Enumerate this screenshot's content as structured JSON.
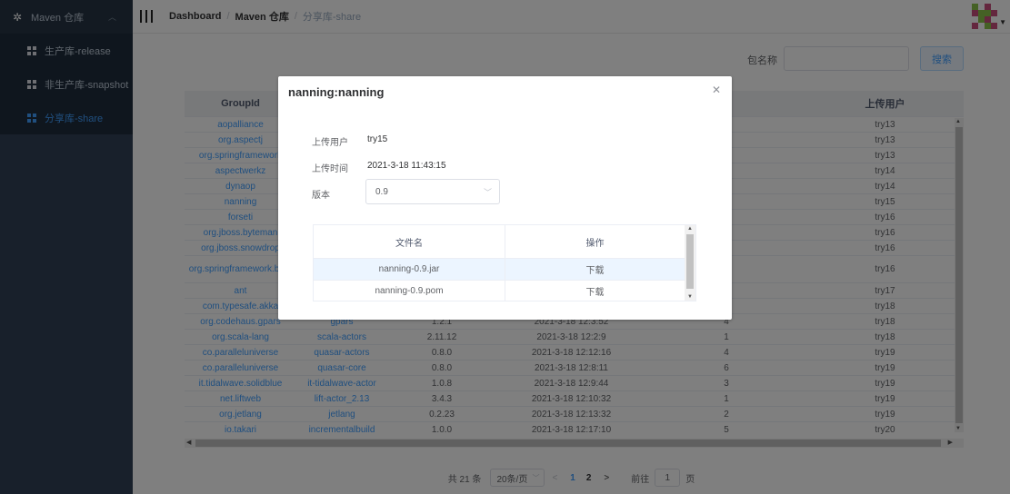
{
  "sidebar": {
    "title": "Maven 仓库",
    "items": [
      {
        "label": "生产库-release",
        "active": false
      },
      {
        "label": "非生产库-snapshot",
        "active": false
      },
      {
        "label": "分享库-share",
        "active": true
      }
    ]
  },
  "header": {
    "breadcrumb": [
      "Dashboard",
      "Maven 仓库",
      "分享库-share"
    ]
  },
  "search": {
    "label": "包名称",
    "value": "",
    "button": "搜索"
  },
  "table": {
    "columns": [
      "GroupId",
      "",
      "",
      "",
      "数",
      "上传用户"
    ],
    "rows": [
      {
        "group": "aopalliance",
        "artifact": "",
        "version": "",
        "time": "",
        "count": "",
        "user": "try13"
      },
      {
        "group": "org.aspectj",
        "artifact": "",
        "version": "",
        "time": "",
        "count": "",
        "user": "try13"
      },
      {
        "group": "org.springframework",
        "artifact": "",
        "version": "",
        "time": "",
        "count": "",
        "user": "try13"
      },
      {
        "group": "aspectwerkz",
        "artifact": "",
        "version": "",
        "time": "",
        "count": "",
        "user": "try14"
      },
      {
        "group": "dynaop",
        "artifact": "",
        "version": "",
        "time": "",
        "count": "",
        "user": "try14"
      },
      {
        "group": "nanning",
        "artifact": "",
        "version": "",
        "time": "",
        "count": "",
        "user": "try15"
      },
      {
        "group": "forseti",
        "artifact": "",
        "version": "",
        "time": "",
        "count": "",
        "user": "try16"
      },
      {
        "group": "org.jboss.byteman",
        "artifact": "",
        "version": "",
        "time": "",
        "count": "",
        "user": "try16"
      },
      {
        "group": "org.jboss.snowdrop",
        "artifact": "",
        "version": "",
        "time": "",
        "count": "",
        "user": "try16"
      },
      {
        "group": "org.springframework.boot",
        "artifact": "",
        "version": "",
        "time": "",
        "count": "",
        "user": "try16",
        "tall": true
      },
      {
        "group": "ant",
        "artifact": "",
        "version": "",
        "time": "",
        "count": "",
        "user": "try17"
      },
      {
        "group": "com.typesafe.akka",
        "artifact": "",
        "version": "",
        "time": "",
        "count": "",
        "user": "try18"
      },
      {
        "group": "org.codehaus.gpars",
        "artifact": "gpars",
        "version": "1.2.1",
        "time": "2021-3-18 12:3:52",
        "count": "4",
        "user": "try18"
      },
      {
        "group": "org.scala-lang",
        "artifact": "scala-actors",
        "version": "2.11.12",
        "time": "2021-3-18 12:2:9",
        "count": "1",
        "user": "try18"
      },
      {
        "group": "co.paralleluniverse",
        "artifact": "quasar-actors",
        "version": "0.8.0",
        "time": "2021-3-18 12:12:16",
        "count": "4",
        "user": "try19"
      },
      {
        "group": "co.paralleluniverse",
        "artifact": "quasar-core",
        "version": "0.8.0",
        "time": "2021-3-18 12:8:11",
        "count": "6",
        "user": "try19"
      },
      {
        "group": "it.tidalwave.solidblue",
        "artifact": "it-tidalwave-actor",
        "version": "1.0.8",
        "time": "2021-3-18 12:9:44",
        "count": "3",
        "user": "try19"
      },
      {
        "group": "net.liftweb",
        "artifact": "lift-actor_2.13",
        "version": "3.4.3",
        "time": "2021-3-18 12:10:32",
        "count": "1",
        "user": "try19"
      },
      {
        "group": "org.jetlang",
        "artifact": "jetlang",
        "version": "0.2.23",
        "time": "2021-3-18 12:13:32",
        "count": "2",
        "user": "try19"
      },
      {
        "group": "io.takari",
        "artifact": "incrementalbuild",
        "version": "1.0.0",
        "time": "2021-3-18 12:17:10",
        "count": "5",
        "user": "try20"
      }
    ]
  },
  "pager": {
    "total": "共 21 条",
    "size": "20条/页",
    "pages": [
      "1",
      "2"
    ],
    "current": "1",
    "goto_label": "前往",
    "goto_value": "1",
    "page_unit": "页"
  },
  "modal": {
    "title": "nanning:nanning",
    "uploader_label": "上传用户",
    "uploader": "try15",
    "time_label": "上传时间",
    "time": "2021-3-18 11:43:15",
    "version_label": "版本",
    "version": "0.9",
    "files_header": [
      "文件名",
      "操作"
    ],
    "files": [
      {
        "name": "nanning-0.9.jar",
        "action": "下载"
      },
      {
        "name": "nanning-0.9.pom",
        "action": "下载"
      }
    ]
  },
  "colors": {
    "sidebar_bg": "#304156",
    "accent": "#409eff"
  }
}
